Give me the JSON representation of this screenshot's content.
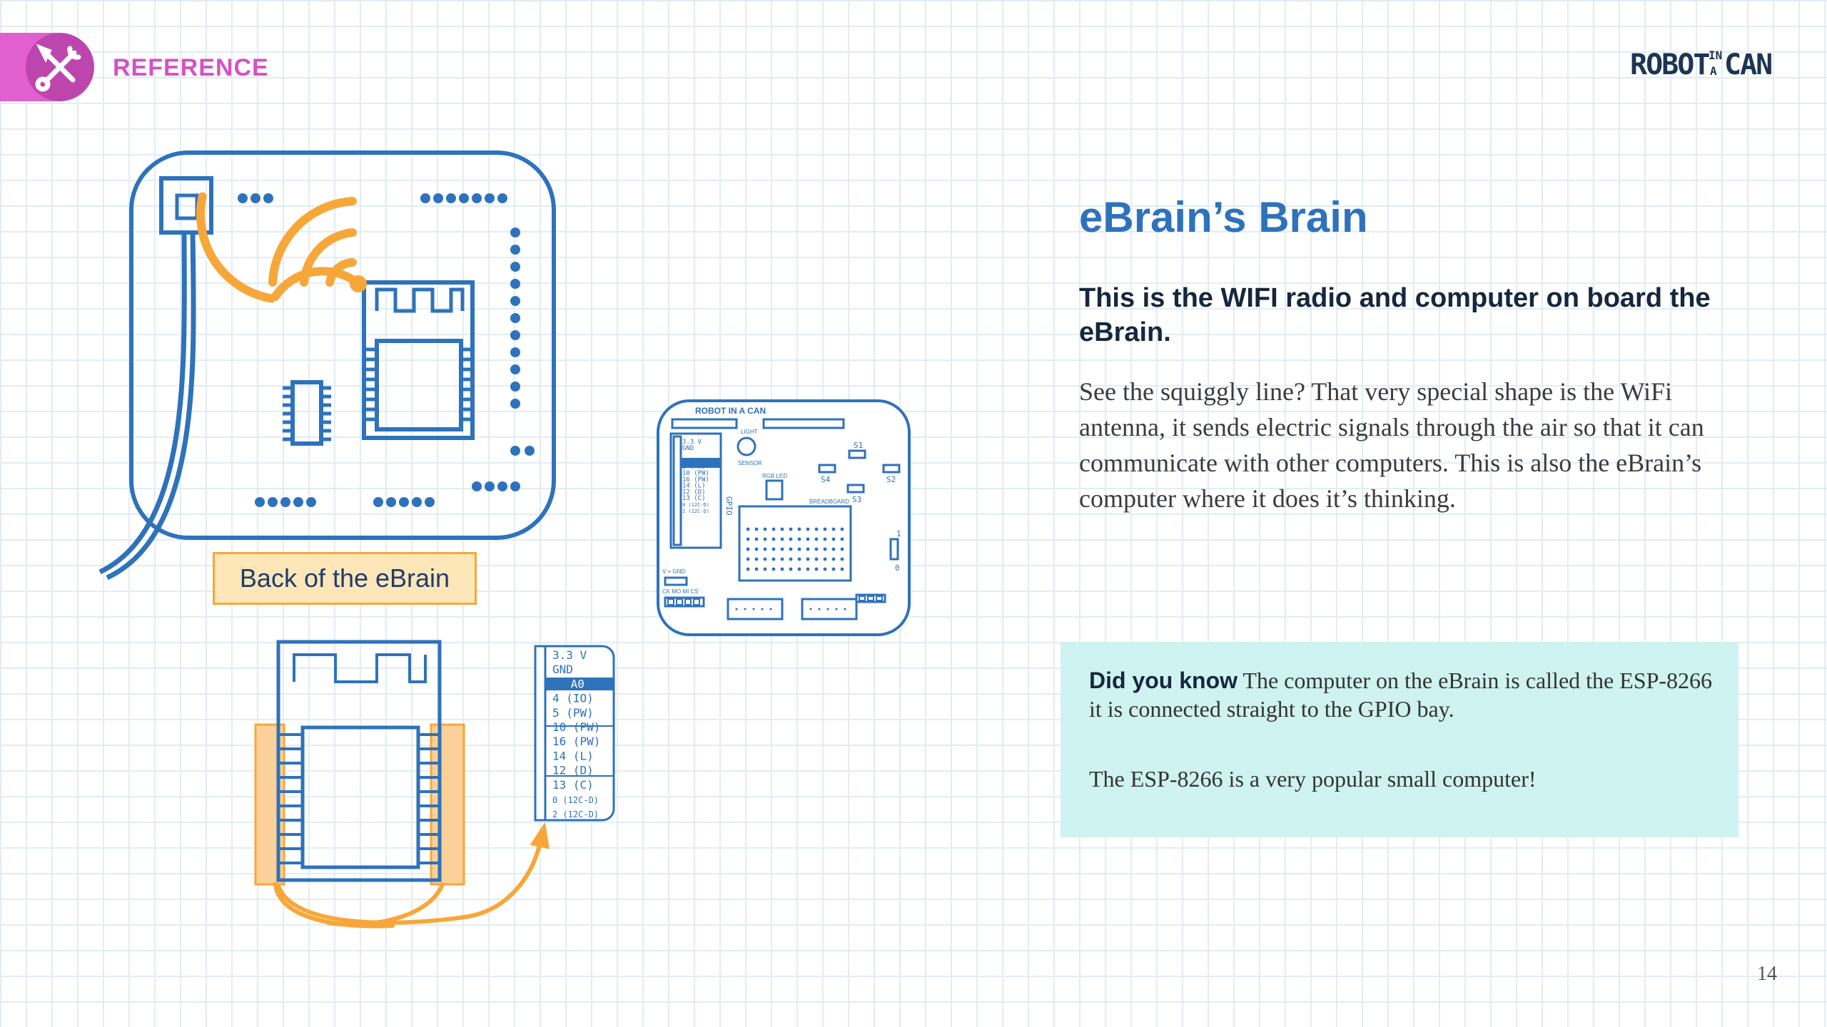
{
  "header": {
    "section_label": "REFERENCE",
    "section_icon": "tools-icon",
    "brand": {
      "word1": "ROBOT",
      "small1": "IN",
      "small2": "A",
      "word2": "CAN"
    }
  },
  "content": {
    "title": "eBrain’s Brain",
    "subtitle": "This is the WIFI radio and computer on board the eBrain.",
    "body": "See the squiggly line? That very special shape is the WiFi antenna, it sends electric signals through the air so that it can communicate with other computers. This is also the eBrain’s computer where it does it’s thinking."
  },
  "callout": {
    "lead": "Did you know",
    "text": " The computer on the eBrain is called the ESP-8266 it is connected straight to the GPIO bay.",
    "text2": "The ESP-8266 is a very popular small computer!"
  },
  "diagram": {
    "caption": "Back of the eBrain",
    "board_title": "ROBOT IN A CAN",
    "gpio_header": "GPIO",
    "small_labels": {
      "light": "LIGHT",
      "sensor": "SENSOR",
      "rgb_led": "RGB LED",
      "breadboard": "BREADBOARD",
      "s1": "S1",
      "s2": "S2",
      "s3": "S3",
      "s4": "S4",
      "one": "1",
      "zero": "0",
      "power": "V + GND",
      "bottom_pins": "CK MO MI CS"
    },
    "gpio_pins": [
      "3.3 V",
      "GND",
      "A0",
      "4 (IO)",
      "5 (PW)",
      "10 (PW)",
      "16 (PW)",
      "14 (L)",
      "12 (D)",
      "13 (C)",
      "0 (12C-D)",
      "2 (12C-D)"
    ],
    "highlight_pin": "A0"
  },
  "colors": {
    "accent_blue": "#2e72bb",
    "accent_orange": "#f7a739",
    "accent_pink": "#e25fd0",
    "callout_bg": "#cef3f1"
  },
  "page": {
    "number": "14"
  }
}
